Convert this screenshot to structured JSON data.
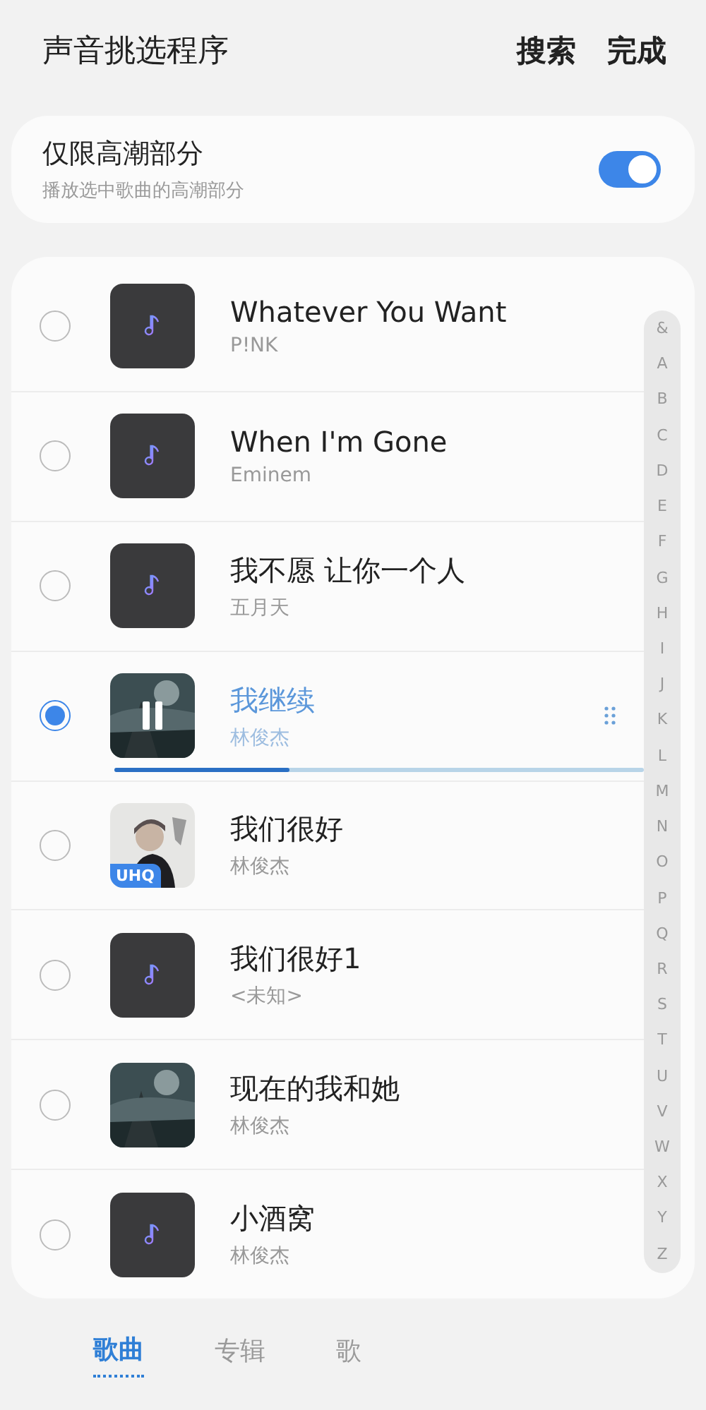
{
  "header": {
    "title": "声音挑选程序",
    "actions": [
      "搜索",
      "完成"
    ]
  },
  "highlight_setting": {
    "title": "仅限高潮部分",
    "subtitle": "播放选中歌曲的高潮部分",
    "on": true
  },
  "songs": [
    {
      "title": "Whatever You Want",
      "artist": "P!NK",
      "selected": false,
      "kind": "note"
    },
    {
      "title": "When I'm Gone",
      "artist": "Eminem",
      "selected": false,
      "kind": "note"
    },
    {
      "title": "我不愿 让你一个人",
      "artist": "五月天",
      "selected": false,
      "kind": "note"
    },
    {
      "title": "我继续",
      "artist": "林俊杰",
      "selected": true,
      "kind": "picture",
      "playing": true,
      "level": 0.33
    },
    {
      "title": "我们很好",
      "artist": "林俊杰",
      "selected": false,
      "kind": "picture",
      "badge": "UHQ"
    },
    {
      "title": "我们很好1",
      "artist": "<未知>",
      "selected": false,
      "kind": "note"
    },
    {
      "title": "现在的我和她",
      "artist": "林俊杰",
      "selected": false,
      "kind": "picture"
    },
    {
      "title": "小酒窝",
      "artist": "林俊杰",
      "selected": false,
      "kind": "note"
    }
  ],
  "index_letters": [
    "&",
    "A",
    "B",
    "C",
    "D",
    "E",
    "F",
    "G",
    "H",
    "I",
    "J",
    "K",
    "L",
    "M",
    "N",
    "O",
    "P",
    "Q",
    "R",
    "S",
    "T",
    "U",
    "V",
    "W",
    "X",
    "Y",
    "Z"
  ],
  "bottom_tabs": [
    {
      "label": "歌曲",
      "selected": true
    },
    {
      "label": "专辑",
      "selected": false
    },
    {
      "label": "歌",
      "selected": false
    }
  ]
}
